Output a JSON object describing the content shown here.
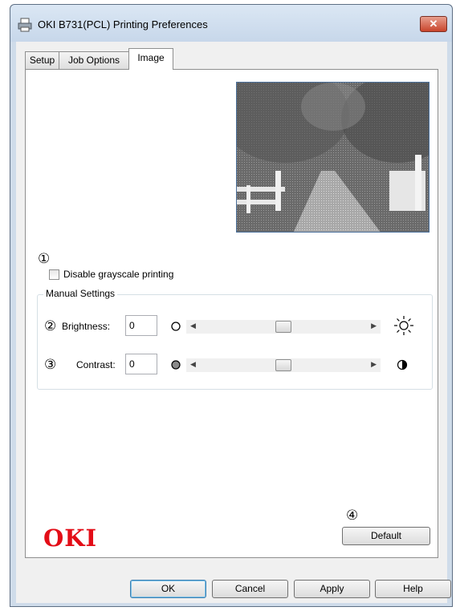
{
  "window": {
    "title": "OKI B731(PCL) Printing Preferences",
    "close_label": "✕"
  },
  "tabs": [
    {
      "label": "Setup",
      "active": false
    },
    {
      "label": "Job Options",
      "active": false
    },
    {
      "label": "Image",
      "active": true
    }
  ],
  "image_tab": {
    "marker_1": "①",
    "disable_grayscale_label": "Disable grayscale printing",
    "disable_grayscale_checked": false,
    "manual_settings": {
      "title": "Manual Settings",
      "brightness": {
        "marker": "②",
        "label": "Brightness:",
        "value": "0",
        "slider_fraction": 0.5,
        "low_icon": "hollow-circle-icon",
        "high_icon": "sun-icon"
      },
      "contrast": {
        "marker": "③",
        "label": "Contrast:",
        "value": "0",
        "slider_fraction": 0.5,
        "low_icon": "gray-circle-icon",
        "high_icon": "half-circle-icon"
      }
    },
    "marker_4": "④",
    "default_button": "Default",
    "logo_text": "OKI"
  },
  "footer": {
    "ok": "OK",
    "cancel": "Cancel",
    "apply": "Apply",
    "help": "Help"
  },
  "colors": {
    "logo": "#e30d17",
    "close_button": "#c9452c",
    "window_frame": "#cfdcea"
  }
}
